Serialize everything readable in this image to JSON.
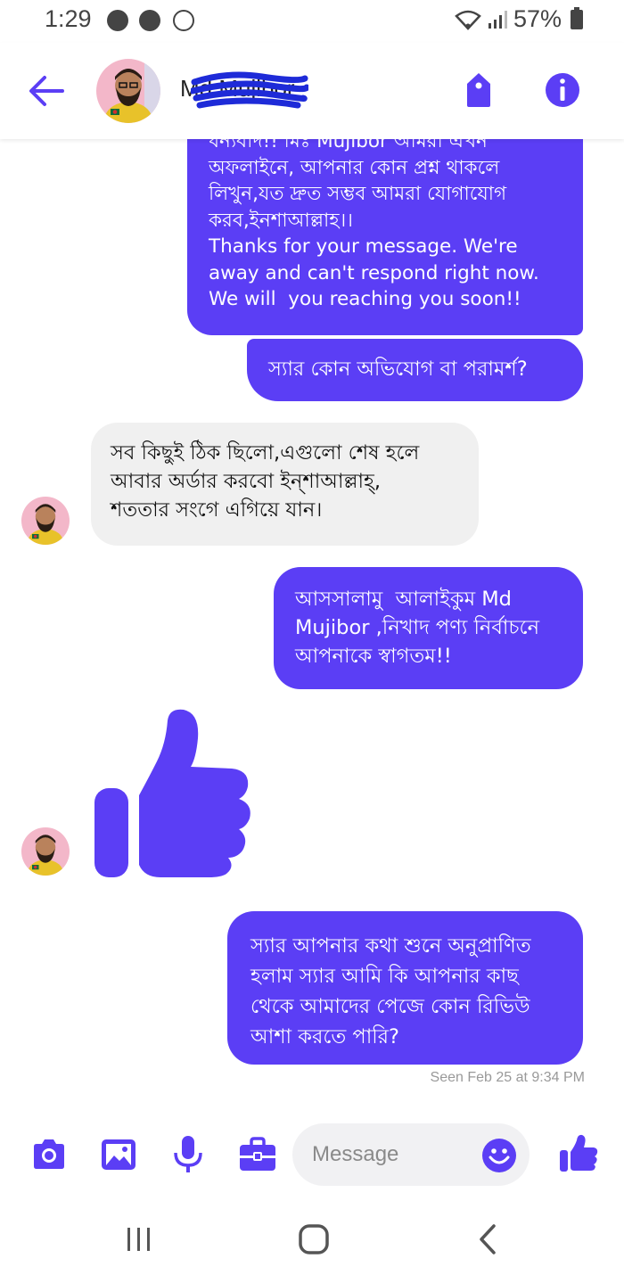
{
  "status_bar": {
    "time": "1:29",
    "battery": "57%",
    "icons": [
      "whatsapp-icon",
      "messenger-icon",
      "messenger-outline-icon",
      "wifi-icon",
      "signal-icon",
      "battery-icon"
    ]
  },
  "header": {
    "contact_name": "Md Mujibor",
    "icons": [
      "back-arrow-icon",
      "tag-icon",
      "info-icon"
    ]
  },
  "accent_color": "#5b3ef5",
  "messages": [
    {
      "from": "me",
      "text": "ধন্যবাদ!! মিঃ Mujibor আমরা এখন\nঅফলাইনে, আপনার কোন প্রশ্ন থাকলে\nলিখুন,যত দ্রুত সম্ভব আমরা যোগাযোগ\nকরব,ইনশাআল্লাহ।।\nThanks for your message. We're\naway and can't respond right now.\nWe will  you reaching you soon!!"
    },
    {
      "from": "me",
      "text": "স্যার কোন অভিযোগ বা পরামর্শ?"
    },
    {
      "from": "contact",
      "text": "সব কিছুই ঠিক ছিলো,এগুলো শেষ হলে\nআবার অর্ডার করবো ইন্শাআল্লাহ্,\nশততার সংগে এগিয়ে যান।"
    },
    {
      "from": "me",
      "text": "আসসালামু  আলাইকুম Md\nMujibor ,নিখাদ পণ্য নির্বাচনে\nআপনাকে স্বাগতম!!"
    },
    {
      "from": "contact",
      "type": "like-sticker"
    },
    {
      "from": "me",
      "text": "স্যার আপনার কথা শুনে অনুপ্রাণিত\nহলাম স্যার আমি কি আপনার কাছ\nথেকে আমাদের পেজে কোন রিভিউ\nআশা করতে পারি?"
    }
  ],
  "seen_status": "Seen Feb 25 at 9:34 PM",
  "composer": {
    "placeholder": "Message",
    "icons": [
      "camera-icon",
      "image-icon",
      "microphone-icon",
      "briefcase-icon",
      "emoji-icon",
      "thumbs-up-icon"
    ]
  },
  "navbar": {
    "icons": [
      "recent-apps-icon",
      "home-icon",
      "back-icon"
    ]
  }
}
